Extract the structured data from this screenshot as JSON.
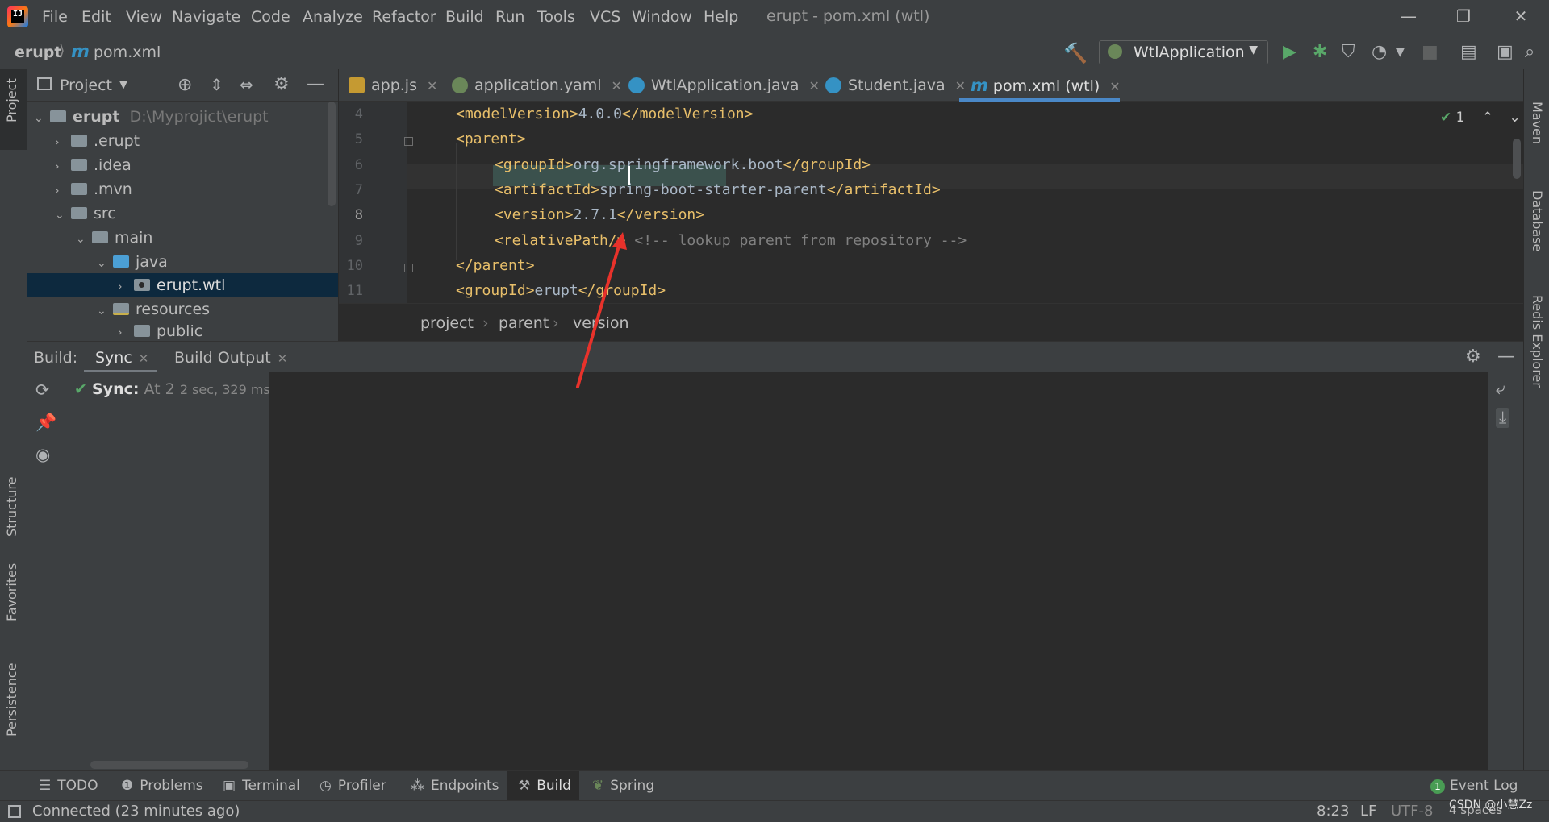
{
  "app": {
    "window_title": "erupt - pom.xml (wtl)",
    "menu": [
      "File",
      "Edit",
      "View",
      "Navigate",
      "Code",
      "Analyze",
      "Refactor",
      "Build",
      "Run",
      "Tools",
      "VCS",
      "Window",
      "Help"
    ]
  },
  "navbar": {
    "breadcrumb_root": "erupt",
    "breadcrumb_file": "pom.xml",
    "run_config": "WtlApplication"
  },
  "left_stripe": {
    "tabs": [
      "Project",
      "Structure",
      "Favorites",
      "Persistence"
    ]
  },
  "right_stripe": {
    "tabs": [
      "Maven",
      "Database",
      "Redis Explorer"
    ]
  },
  "project": {
    "title": "Project",
    "tree": [
      {
        "label": "erupt",
        "hint": "D:\\Myprojict\\erupt"
      },
      {
        "label": ".erupt"
      },
      {
        "label": ".idea"
      },
      {
        "label": ".mvn"
      },
      {
        "label": "src"
      },
      {
        "label": "main"
      },
      {
        "label": "java"
      },
      {
        "label": "erupt.wtl"
      },
      {
        "label": "resources"
      },
      {
        "label": "public"
      }
    ]
  },
  "editor": {
    "tabs": [
      {
        "label": "app.js"
      },
      {
        "label": "application.yaml"
      },
      {
        "label": "WtlApplication.java"
      },
      {
        "label": "Student.java"
      },
      {
        "label": "pom.xml (wtl)"
      }
    ],
    "inspection_count": "1",
    "line_numbers": [
      "4",
      "5",
      "6",
      "7",
      "8",
      "9",
      "10",
      "11"
    ],
    "lines": {
      "l4": {
        "open": "<modelVersion>",
        "text": "4.0.0",
        "close": "</modelVersion>"
      },
      "l5": {
        "open": "<parent>"
      },
      "l6": {
        "open": "<groupId>",
        "text": "org.springframework.boot",
        "close": "</groupId>"
      },
      "l7": {
        "open": "<artifactId>",
        "text": "spring-boot-starter-parent",
        "close": "</artifactId>"
      },
      "l8": {
        "open": "<version>",
        "text": "2.7.1",
        "close": "</version>"
      },
      "l9": {
        "open": "<relativePath/>",
        "comment": "<!-- lookup parent from repository -->"
      },
      "l10": {
        "close": "</parent>"
      },
      "l11": {
        "open": "<groupId>",
        "text": "erupt",
        "close": "</groupId>"
      }
    },
    "breadcrumbs": [
      "project",
      "parent",
      "version"
    ]
  },
  "build": {
    "label": "Build:",
    "tabs": [
      "Sync",
      "Build Output"
    ],
    "sync_item": {
      "title": "Sync:",
      "text": "At 2",
      "time": "2 sec, 329 ms"
    }
  },
  "tool_tabs": [
    "TODO",
    "Problems",
    "Terminal",
    "Profiler",
    "Endpoints",
    "Build",
    "Spring"
  ],
  "event_log": {
    "label": "Event Log",
    "count": "1"
  },
  "status": {
    "message": "Connected (23 minutes ago)",
    "position": "8:23",
    "line_sep": "LF",
    "encoding": "UTF-8",
    "indent": "4 spaces",
    "watermark": "CSDN @小慧Zz"
  },
  "colors": {
    "accent": "#4a88c7",
    "tag": "#e8bf6a",
    "selection": "#0d293e",
    "annotation": "#e8322b"
  }
}
